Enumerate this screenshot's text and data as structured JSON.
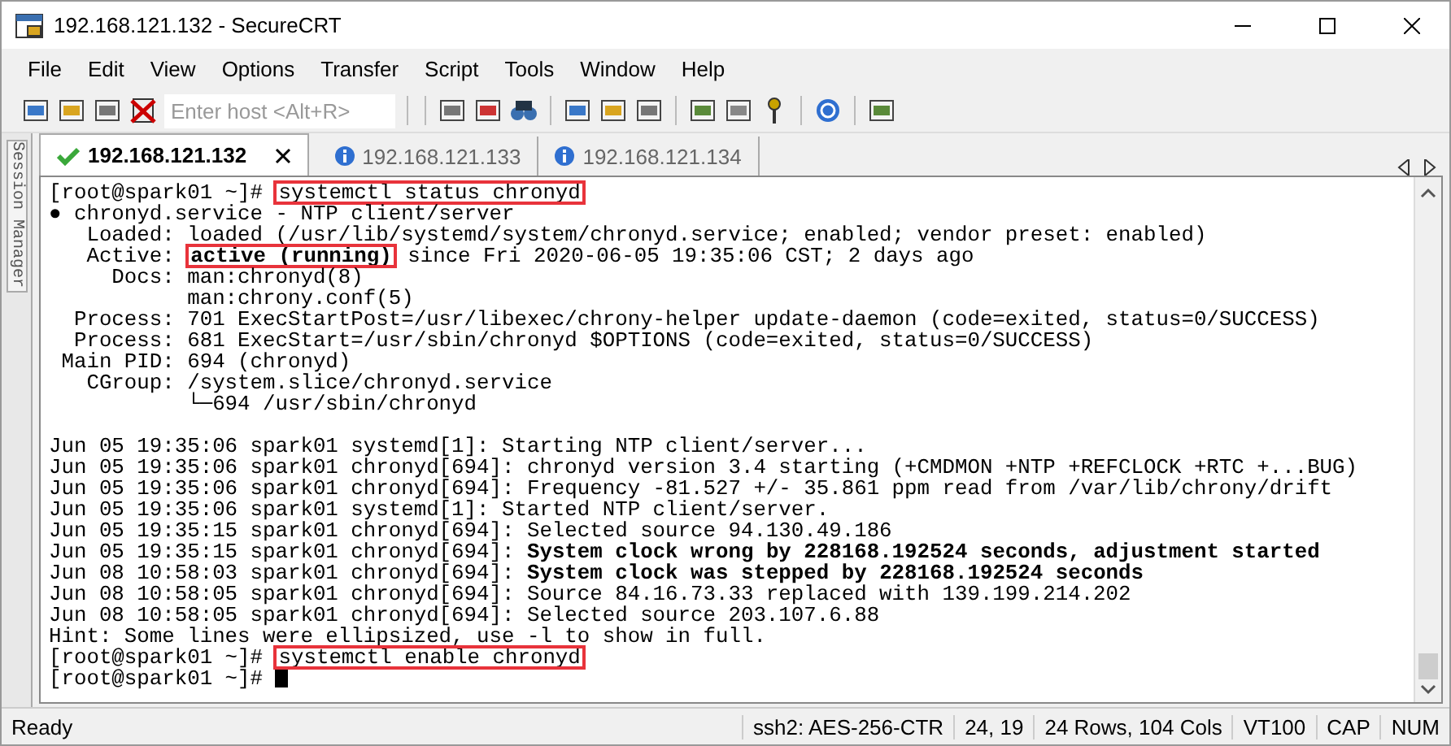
{
  "window": {
    "title": "192.168.121.132 - SecureCRT"
  },
  "menu": [
    "File",
    "Edit",
    "View",
    "Options",
    "Transfer",
    "Script",
    "Tools",
    "Window",
    "Help"
  ],
  "toolbar": {
    "host_field": {
      "placeholder": "Enter host <Alt+R>"
    }
  },
  "session_manager": {
    "label": "Session Manager"
  },
  "tabs": [
    {
      "label": "192.168.121.132",
      "selected": true,
      "kind": "connected"
    },
    {
      "label": "192.168.121.133",
      "selected": false,
      "kind": "info"
    },
    {
      "label": "192.168.121.134",
      "selected": false,
      "kind": "info"
    }
  ],
  "terminal": {
    "lines": [
      {
        "kind": "text",
        "segments": [
          {
            "text": "[root@spark01 ~]#",
            "boxed": false
          },
          {
            "text": "systemctl status chronyd",
            "boxed": true
          }
        ]
      },
      {
        "kind": "text",
        "segments": [
          {
            "text": "● chronyd.service - NTP client/server",
            "boxed": false
          }
        ]
      },
      {
        "kind": "text",
        "segments": [
          {
            "text": "   Loaded: loaded (/usr/lib/systemd/system/chronyd.service; enabled; vendor preset: enabled)",
            "boxed": false
          }
        ]
      },
      {
        "kind": "text",
        "segments": [
          {
            "text": "   Active:",
            "boxed": false
          },
          {
            "text": "**active (running)**",
            "boxed": true
          },
          {
            "text": "since Fri 2020-06-05 19:35:06 CST; 2 days ago",
            "boxed": false
          }
        ]
      },
      {
        "kind": "text",
        "segments": [
          {
            "text": "     Docs: man:chronyd(8)",
            "boxed": false
          }
        ]
      },
      {
        "kind": "text",
        "segments": [
          {
            "text": "           man:chrony.conf(5)",
            "boxed": false
          }
        ]
      },
      {
        "kind": "text",
        "segments": [
          {
            "text": "  Process: 701 ExecStartPost=/usr/libexec/chrony-helper update-daemon (code=exited, status=0/SUCCESS)",
            "boxed": false
          }
        ]
      },
      {
        "kind": "text",
        "segments": [
          {
            "text": "  Process: 681 ExecStart=/usr/sbin/chronyd $OPTIONS (code=exited, status=0/SUCCESS)",
            "boxed": false
          }
        ]
      },
      {
        "kind": "text",
        "segments": [
          {
            "text": " Main PID: 694 (chronyd)",
            "boxed": false
          }
        ]
      },
      {
        "kind": "text",
        "segments": [
          {
            "text": "   CGroup: /system.slice/chronyd.service",
            "boxed": false
          }
        ]
      },
      {
        "kind": "text",
        "segments": [
          {
            "text": "           └─694 /usr/sbin/chronyd",
            "boxed": false
          }
        ]
      },
      {
        "kind": "blank"
      },
      {
        "kind": "text",
        "segments": [
          {
            "text": "Jun 05 19:35:06 spark01 systemd[1]: Starting NTP client/server...",
            "boxed": false
          }
        ]
      },
      {
        "kind": "text",
        "segments": [
          {
            "text": "Jun 05 19:35:06 spark01 chronyd[694]: chronyd version 3.4 starting (+CMDMON +NTP +REFCLOCK +RTC +...BUG)",
            "boxed": false
          }
        ]
      },
      {
        "kind": "text",
        "segments": [
          {
            "text": "Jun 05 19:35:06 spark01 chronyd[694]: Frequency -81.527 +/- 35.861 ppm read from /var/lib/chrony/drift",
            "boxed": false
          }
        ]
      },
      {
        "kind": "text",
        "segments": [
          {
            "text": "Jun 05 19:35:06 spark01 systemd[1]: Started NTP client/server.",
            "boxed": false
          }
        ]
      },
      {
        "kind": "text",
        "segments": [
          {
            "text": "Jun 05 19:35:15 spark01 chronyd[694]: Selected source 94.130.49.186",
            "boxed": false
          }
        ]
      },
      {
        "kind": "text",
        "segments": [
          {
            "text": "Jun 05 19:35:15 spark01 chronyd[694]: **System clock wrong by 228168.192524 seconds, adjustment started**",
            "boxed": false
          }
        ]
      },
      {
        "kind": "text",
        "segments": [
          {
            "text": "Jun 08 10:58:03 spark01 chronyd[694]: **System clock was stepped by 228168.192524 seconds**",
            "boxed": false
          }
        ]
      },
      {
        "kind": "text",
        "segments": [
          {
            "text": "Jun 08 10:58:05 spark01 chronyd[694]: Source 84.16.73.33 replaced with 139.199.214.202",
            "boxed": false
          }
        ]
      },
      {
        "kind": "text",
        "segments": [
          {
            "text": "Jun 08 10:58:05 spark01 chronyd[694]: Selected source 203.107.6.88",
            "boxed": false
          }
        ]
      },
      {
        "kind": "text",
        "segments": [
          {
            "text": "Hint: Some lines were ellipsized, use -l to show in full.",
            "boxed": false
          }
        ]
      },
      {
        "kind": "text",
        "segments": [
          {
            "text": "[root@spark01 ~]#",
            "boxed": false
          },
          {
            "text": "systemctl enable chronyd",
            "boxed": true
          }
        ]
      },
      {
        "kind": "text",
        "cursor": true,
        "segments": [
          {
            "text": "[root@spark01 ~]#",
            "boxed": false
          }
        ]
      }
    ]
  },
  "status_bar": [
    "Ready",
    "ssh2: AES-256-CTR",
    "24,  19",
    "24 Rows, 104 Cols",
    "VT100",
    "CAP",
    "NUM"
  ]
}
